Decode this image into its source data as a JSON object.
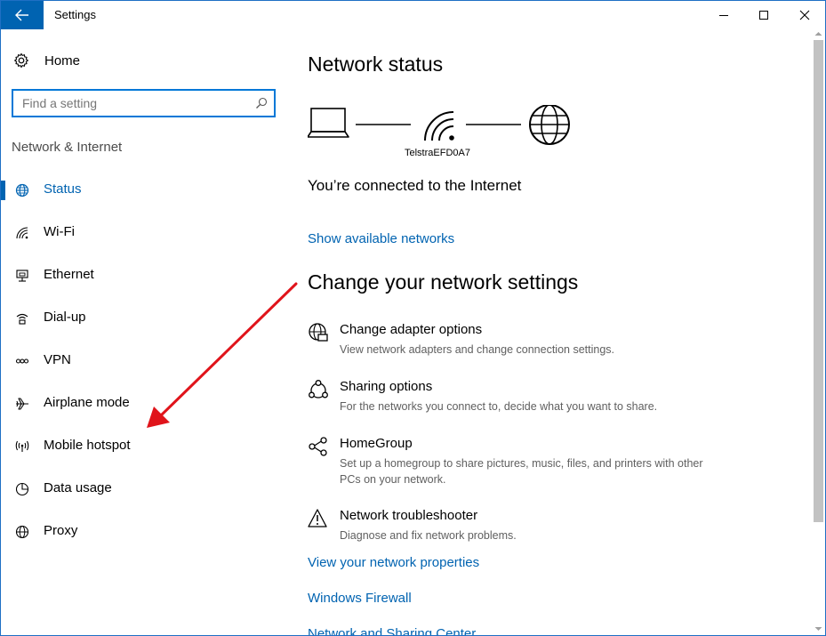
{
  "window": {
    "title": "Settings"
  },
  "sidebar": {
    "home_label": "Home",
    "search_placeholder": "Find a setting",
    "section_label": "Network & Internet",
    "items": [
      {
        "label": "Status",
        "icon": "globe-icon",
        "active": true
      },
      {
        "label": "Wi-Fi",
        "icon": "wifi-icon"
      },
      {
        "label": "Ethernet",
        "icon": "ethernet-icon"
      },
      {
        "label": "Dial-up",
        "icon": "dialup-icon"
      },
      {
        "label": "VPN",
        "icon": "vpn-icon"
      },
      {
        "label": "Airplane mode",
        "icon": "airplane-icon"
      },
      {
        "label": "Mobile hotspot",
        "icon": "hotspot-icon"
      },
      {
        "label": "Data usage",
        "icon": "data-usage-icon"
      },
      {
        "label": "Proxy",
        "icon": "proxy-globe-icon"
      }
    ]
  },
  "main": {
    "network_status_heading": "Network status",
    "network_name": "TelstraEFD0A7",
    "connected_text": "You’re connected to the Internet",
    "show_networks_link": "Show available networks",
    "change_heading": "Change your network settings",
    "options": [
      {
        "title": "Change adapter options",
        "desc": "View network adapters and change connection settings.",
        "icon": "adapter-icon"
      },
      {
        "title": "Sharing options",
        "desc": "For the networks you connect to, decide what you want to share.",
        "icon": "sharing-icon"
      },
      {
        "title": "HomeGroup",
        "desc": "Set up a homegroup to share pictures, music, files, and printers with other PCs on your network.",
        "icon": "homegroup-icon"
      },
      {
        "title": "Network troubleshooter",
        "desc": "Diagnose and fix network problems.",
        "icon": "warning-icon"
      }
    ],
    "links": [
      "View your network properties",
      "Windows Firewall",
      "Network and Sharing Center"
    ]
  },
  "colors": {
    "accent": "#0063b1",
    "annotation_arrow": "#e0141b"
  }
}
